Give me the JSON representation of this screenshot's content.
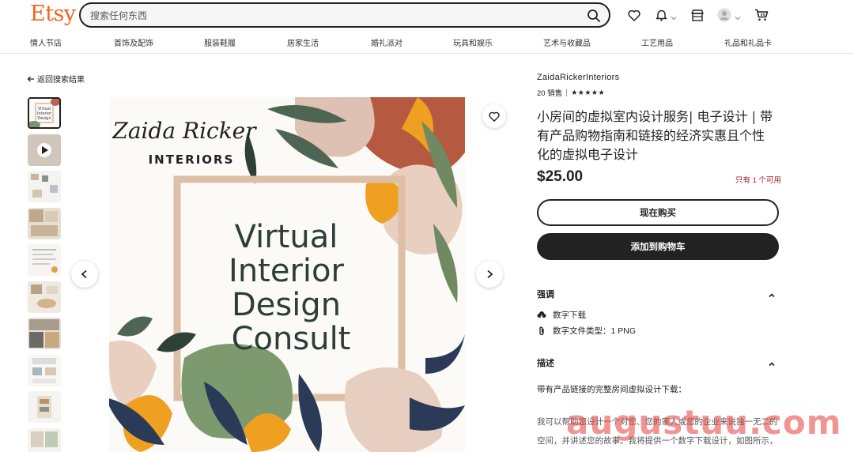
{
  "header": {
    "logo": "Etsy",
    "search_placeholder": "搜索任何东西"
  },
  "nav": {
    "items": [
      "情人节店",
      "首饰及配饰",
      "服装鞋履",
      "居家生活",
      "婚礼派对",
      "玩具和娱乐",
      "艺术与收藏品",
      "工艺用品",
      "礼品和礼品卡"
    ]
  },
  "back_link": "返回搜索结果",
  "gallery": {
    "thumbnail_count": 10,
    "active_index": 0
  },
  "main_image": {
    "brand_script": "Zaida Ricker",
    "brand_caps": "INTERIORS",
    "line1": "Virtual",
    "line2": "Interior",
    "line3": "Design",
    "line4": "Consult"
  },
  "listing": {
    "shop_name": "ZaidaRickerInteriors",
    "sales": "20 销售",
    "rating_stars": "★★★★★",
    "title": "小房间的虚拟室内设计服务| 电子设计 | 带有产品购物指南和链接的经济实惠且个性化的虚拟电子设计",
    "price": "$25.00",
    "stock": "只有 1 个可用",
    "buy_now": "现在购买",
    "add_to_cart": "添加到购物车"
  },
  "highlights": {
    "heading": "强调",
    "items": [
      {
        "icon": "cloud-download-icon",
        "text": "数字下载"
      },
      {
        "icon": "paperclip-icon",
        "text": "数字文件类型：1 PNG"
      }
    ]
  },
  "description": {
    "heading": "描述",
    "intro": "带有产品链接的完整房间虚拟设计下载：",
    "body": "我可以帮助您设计一个对您、您的家人或您的企业来说独一无二的空间，并讲述您的故事。我将提供一个数字下载设计，如图所示，带有所有家具和配件选择的链接，以及设置说明"
  },
  "watermark": "augustuu.com",
  "colors": {
    "brand": "#f1641e",
    "dark": "#222222",
    "stock_red": "#a61a2e"
  }
}
